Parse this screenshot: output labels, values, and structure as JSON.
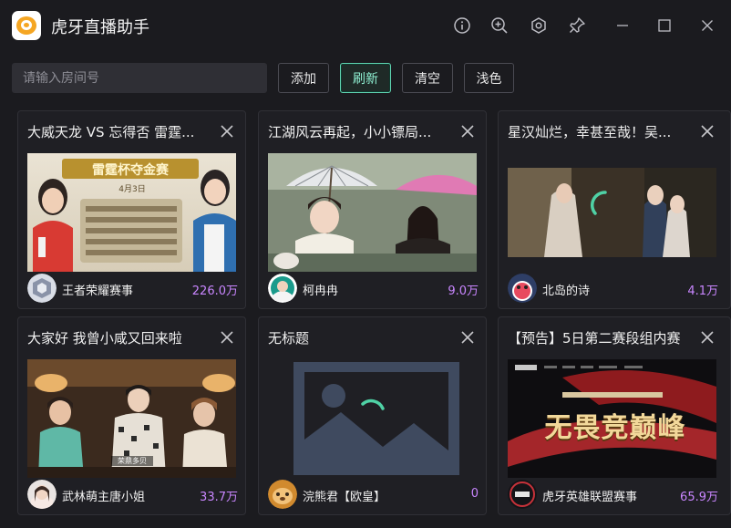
{
  "app": {
    "title": "虎牙直播助手",
    "logo_icon": "huya-logo-icon"
  },
  "titlebar": {
    "icons": [
      "info-icon",
      "zoom-in-icon",
      "settings-icon",
      "pin-icon",
      "minimize-icon",
      "maximize-icon",
      "close-icon"
    ]
  },
  "toolbar": {
    "search_placeholder": "请输入房间号",
    "add_label": "添加",
    "refresh_label": "刷新",
    "clear_label": "清空",
    "theme_label": "浅色"
  },
  "colors": {
    "accent": "#5fd3b0",
    "viewers": "#c986ff",
    "background": "#1b1b1f"
  },
  "cards": [
    {
      "title": "大威天龙 VS 忘得否 雷霆...",
      "streamer": "王者荣耀赛事",
      "viewers": "226.0万"
    },
    {
      "title": "江湖风云再起，小小镖局...",
      "streamer": "柯冉冉",
      "viewers": "9.0万"
    },
    {
      "title": "星汉灿烂，幸甚至哉！吴...",
      "streamer": "北岛的诗",
      "viewers": "4.1万"
    },
    {
      "title": "大家好 我曾小咸又回来啦",
      "streamer": "武林萌主唐小姐",
      "viewers": "33.7万"
    },
    {
      "title": "无标题",
      "streamer": "浣熊君【欧皇】",
      "viewers": "0"
    },
    {
      "title": "【预告】5日第二赛段组内赛",
      "streamer": "虎牙英雄联盟赛事",
      "viewers": "65.9万"
    }
  ],
  "thumbnails": {
    "c0": {
      "banner": "雷霆杯夺金赛",
      "date": "4月3日"
    },
    "c3": {
      "caption": "荣鼎多贝"
    },
    "c5": {
      "line1": "无畏竞巅峰"
    }
  }
}
